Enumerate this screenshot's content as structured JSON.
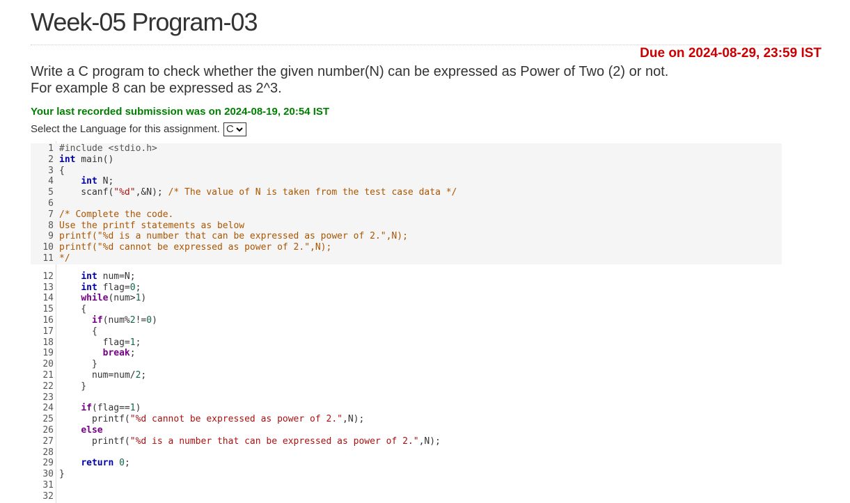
{
  "title": "Week-05 Program-03",
  "due": "Due on 2024-08-29, 23:59 IST",
  "question": [
    "Write a C program to check whether the given number(N) can be expressed as Power of Two (2) or not.",
    "For example 8 can be expressed as 2^3."
  ],
  "last_submission": "Your last recorded submission was on 2024-08-19, 20:54 IST",
  "language": {
    "label": "Select the Language for this assignment.",
    "selected": "C"
  },
  "editor": {
    "lines": [
      "#include <stdio.h>",
      "int main()",
      "{",
      "    int N;",
      "    scanf(\"%d\",&N); /* The value of N is taken from the test case data */",
      "",
      "/* Complete the code.",
      "Use the printf statements as below",
      "printf(\"%d is a number that can be expressed as power of 2.\",N);",
      "printf(\"%d cannot be expressed as power of 2.\",N);",
      "*/",
      "    int num=N;",
      "    int flag=0;",
      "    while(num>1)",
      "    {",
      "      if(num%2!=0)",
      "      {",
      "        flag=1;",
      "        break;",
      "      }",
      "      num=num/2;",
      "    }",
      "",
      "    if(flag==1)",
      "      printf(\"%d cannot be expressed as power of 2.\",N);",
      "    else",
      "      printf(\"%d is a number that can be expressed as power of 2.\",N);",
      "",
      "    return 0;",
      "}",
      "",
      ""
    ],
    "readonly_lines": 11
  }
}
